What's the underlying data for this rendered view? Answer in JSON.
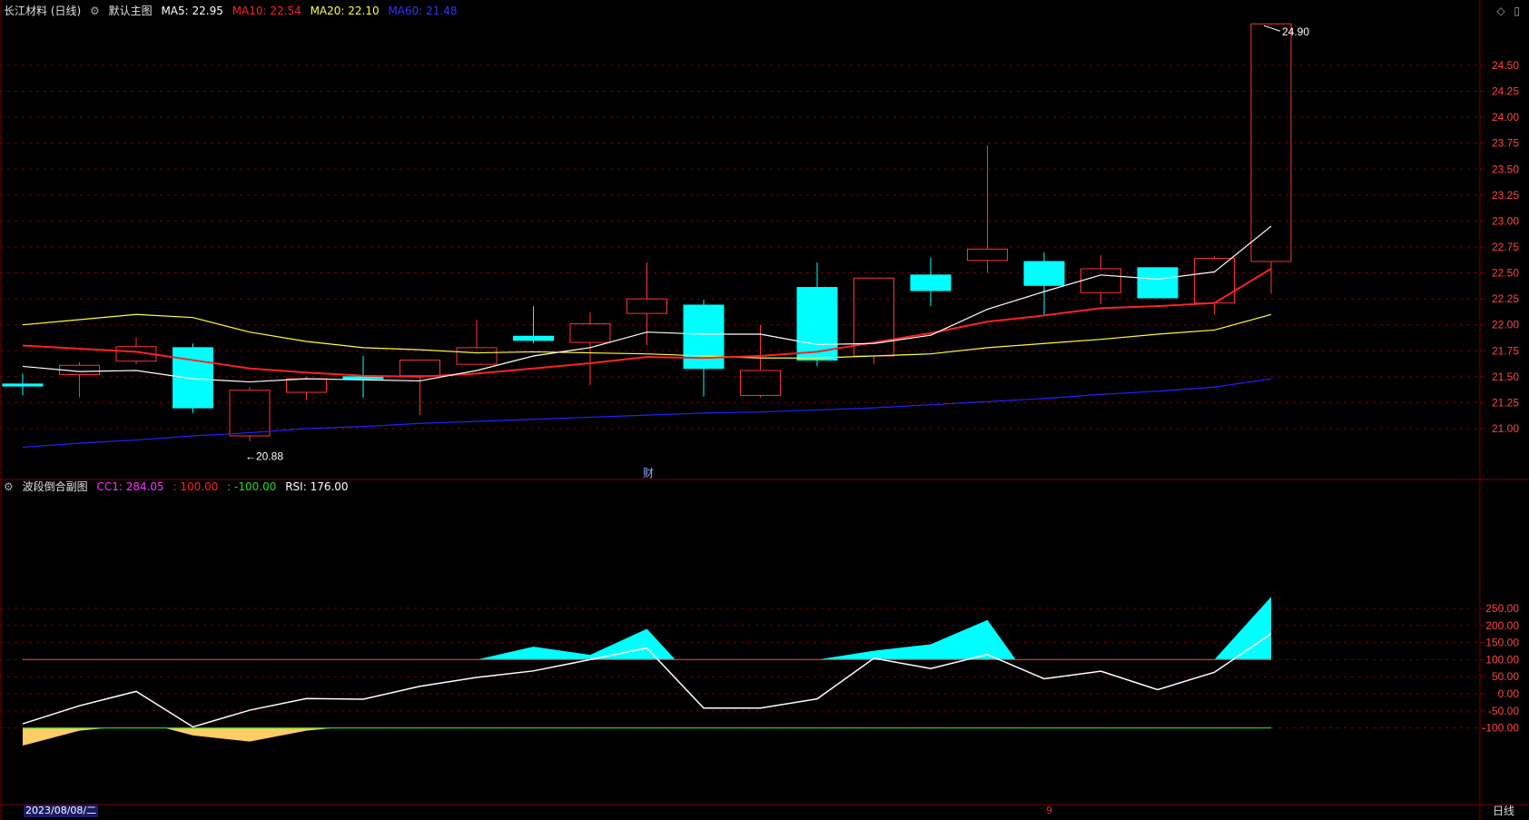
{
  "header": {
    "stock_name": "长江材料 (日线)",
    "indicator_label": "默认主图",
    "ma5_label": "MA5: 22.95",
    "ma10_label": "MA10: 22.54",
    "ma20_label": "MA20: 22.10",
    "ma60_label": "MA60: 21.48"
  },
  "sub_header": {
    "indicator_label": "波段倒合副图",
    "cc1_label": "CC1: 284.05",
    "upper_label": ": 100.00",
    "lower_label": ": -100.00",
    "rsi_label": "RSI: 176.00"
  },
  "footer": {
    "date": "2023/08/08/二",
    "period": "日线",
    "mid_marker": "9"
  },
  "annotations": {
    "high_label": "24.90",
    "low_label": "←20.88",
    "cai_mark": "财"
  },
  "colors": {
    "up": "#ff3333",
    "down": "#00ffff",
    "ma5": "#ffffff",
    "ma10": "#ff2222",
    "ma20": "#ffff33",
    "ma60": "#2222ff",
    "grid": "#7a0000",
    "cc1_fill_pos": "#00ffff",
    "cc1_fill_neg": "#ffcc66",
    "rsi_line": "#ffffff",
    "upper_line": "#ff2222",
    "lower_line": "#22cc22"
  },
  "chart_data": [
    {
      "type": "candlestick",
      "ylim": [
        20.6,
        25.2
      ],
      "y_ticks": [
        "24.50",
        "24.25",
        "24.00",
        "23.75",
        "23.50",
        "23.25",
        "23.00",
        "22.75",
        "22.50",
        "22.25",
        "22.00",
        "21.75",
        "21.50",
        "21.25",
        "21.00"
      ],
      "candles": [
        {
          "o": 21.43,
          "h": 21.53,
          "l": 21.32,
          "c": 21.41
        },
        {
          "o": 21.52,
          "h": 21.64,
          "l": 21.3,
          "c": 21.61
        },
        {
          "o": 21.65,
          "h": 21.88,
          "l": 21.62,
          "c": 21.79
        },
        {
          "o": 21.78,
          "h": 21.82,
          "l": 21.15,
          "c": 21.2
        },
        {
          "o": 20.93,
          "h": 21.4,
          "l": 20.88,
          "c": 21.37
        },
        {
          "o": 21.35,
          "h": 21.5,
          "l": 21.28,
          "c": 21.48
        },
        {
          "o": 21.5,
          "h": 21.7,
          "l": 21.3,
          "c": 21.48
        },
        {
          "o": 21.51,
          "h": 21.66,
          "l": 21.13,
          "c": 21.66
        },
        {
          "o": 21.62,
          "h": 22.05,
          "l": 21.62,
          "c": 21.78
        },
        {
          "o": 21.89,
          "h": 22.18,
          "l": 21.82,
          "c": 21.85
        },
        {
          "o": 21.83,
          "h": 22.12,
          "l": 21.42,
          "c": 22.01
        },
        {
          "o": 22.11,
          "h": 22.6,
          "l": 21.8,
          "c": 22.25
        },
        {
          "o": 22.19,
          "h": 22.24,
          "l": 21.31,
          "c": 21.58
        },
        {
          "o": 21.32,
          "h": 22.0,
          "l": 21.3,
          "c": 21.56
        },
        {
          "o": 22.36,
          "h": 22.6,
          "l": 21.6,
          "c": 21.66
        },
        {
          "o": 21.7,
          "h": 22.45,
          "l": 21.62,
          "c": 22.45
        },
        {
          "o": 22.48,
          "h": 22.65,
          "l": 22.18,
          "c": 22.33
        },
        {
          "o": 22.62,
          "h": 23.73,
          "l": 22.5,
          "c": 22.73
        },
        {
          "o": 22.61,
          "h": 22.7,
          "l": 22.1,
          "c": 22.38
        },
        {
          "o": 22.31,
          "h": 22.67,
          "l": 22.2,
          "c": 22.54
        },
        {
          "o": 22.55,
          "h": 22.55,
          "l": 22.26,
          "c": 22.26
        },
        {
          "o": 22.21,
          "h": 22.66,
          "l": 22.1,
          "c": 22.64
        },
        {
          "o": 22.61,
          "h": 24.9,
          "l": 22.3,
          "c": 24.9
        }
      ],
      "ma5": [
        21.6,
        21.55,
        21.56,
        21.48,
        21.45,
        21.48,
        21.47,
        21.46,
        21.56,
        21.7,
        21.78,
        21.93,
        21.91,
        21.91,
        21.81,
        21.82,
        21.9,
        22.15,
        22.32,
        22.48,
        22.44,
        22.51,
        22.95
      ],
      "ma10": [
        21.8,
        21.77,
        21.74,
        21.66,
        21.58,
        21.54,
        21.51,
        21.5,
        21.53,
        21.58,
        21.63,
        21.69,
        21.68,
        21.7,
        21.74,
        21.83,
        21.92,
        22.03,
        22.09,
        22.16,
        22.18,
        22.21,
        22.54
      ],
      "ma20": [
        22.0,
        22.05,
        22.1,
        22.07,
        21.93,
        21.84,
        21.78,
        21.76,
        21.73,
        21.74,
        21.73,
        21.72,
        21.7,
        21.68,
        21.68,
        21.7,
        21.72,
        21.78,
        21.82,
        21.86,
        21.91,
        21.95,
        22.1
      ],
      "ma60": [
        20.82,
        20.86,
        20.89,
        20.93,
        20.96,
        21.0,
        21.02,
        21.05,
        21.07,
        21.09,
        21.11,
        21.13,
        21.15,
        21.16,
        21.18,
        21.2,
        21.23,
        21.26,
        21.29,
        21.33,
        21.36,
        21.4,
        21.48
      ]
    },
    {
      "type": "line",
      "ylim": [
        -170,
        300
      ],
      "y_ticks": [
        "250.00",
        "200.00",
        "150.00",
        "100.00",
        "50.00",
        "0.00",
        "-50.00",
        "-100.00"
      ],
      "rsi": [
        -88,
        -35,
        7,
        -97,
        -48,
        -14,
        -16,
        22,
        48,
        67,
        100,
        134,
        -42,
        -42,
        -15,
        104,
        74,
        115,
        44,
        66,
        12,
        63,
        176
      ],
      "cc1": [
        -152,
        -108,
        0,
        -122,
        -140,
        -108,
        0,
        0,
        0,
        138,
        114,
        190,
        0,
        0,
        0,
        126,
        145,
        216,
        0,
        0,
        0,
        0,
        284
      ]
    }
  ]
}
